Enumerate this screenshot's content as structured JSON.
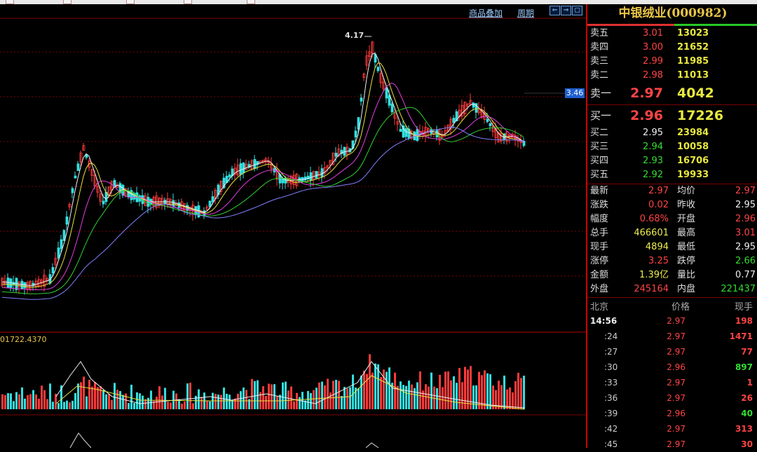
{
  "toolbar": {
    "overlay": "商品叠加",
    "period": "周期",
    "btn1": "⇐",
    "btn2": "⇒",
    "btn3": "▢"
  },
  "chart": {
    "high_label": "4.17",
    "price_tag": "3.46",
    "volume_label": "01722.4370"
  },
  "stock": {
    "name": "中银绒业(000982)"
  },
  "order_book": {
    "asks": [
      {
        "label": "卖五",
        "price": "3.01",
        "vol": "13023"
      },
      {
        "label": "卖四",
        "price": "3.00",
        "vol": "21652"
      },
      {
        "label": "卖三",
        "price": "2.99",
        "vol": "11985"
      },
      {
        "label": "卖二",
        "price": "2.98",
        "vol": "11013"
      },
      {
        "label": "卖一",
        "price": "2.97",
        "vol": "4042"
      }
    ],
    "bids": [
      {
        "label": "买一",
        "price": "2.96",
        "vol": "17226"
      },
      {
        "label": "买二",
        "price": "2.95",
        "vol": "23984"
      },
      {
        "label": "买三",
        "price": "2.94",
        "vol": "10058"
      },
      {
        "label": "买四",
        "price": "2.93",
        "vol": "16706"
      },
      {
        "label": "买五",
        "price": "2.92",
        "vol": "19933"
      }
    ]
  },
  "stats": [
    {
      "l1": "最新",
      "v1": "2.97",
      "l2": "均价",
      "v2": "2.97"
    },
    {
      "l1": "涨跌",
      "v1": "0.02",
      "l2": "昨收",
      "v2": "2.95"
    },
    {
      "l1": "幅度",
      "v1": "0.68%",
      "l2": "开盘",
      "v2": "2.96"
    },
    {
      "l1": "总手",
      "v1": "466601",
      "l2": "最高",
      "v2": "3.01"
    },
    {
      "l1": "现手",
      "v1": "4894",
      "l2": "最低",
      "v2": "2.95"
    },
    {
      "l1": "涨停",
      "v1": "3.25",
      "l2": "跌停",
      "v2": "2.66"
    },
    {
      "l1": "金额",
      "v1": "1.39亿",
      "l2": "量比",
      "v2": "0.77"
    },
    {
      "l1": "外盘",
      "v1": "245164",
      "l2": "内盘",
      "v2": "221437"
    }
  ],
  "ticks_header": {
    "place": "北京",
    "price": "价格",
    "vol": "现手"
  },
  "ticks": [
    {
      "time": "14:56",
      "price": "2.97",
      "vol": "198"
    },
    {
      "time": ":24",
      "price": "2.97",
      "vol": "1471"
    },
    {
      "time": ":27",
      "price": "2.97",
      "vol": "77"
    },
    {
      "time": ":30",
      "price": "2.96",
      "vol": "897"
    },
    {
      "time": ":33",
      "price": "2.97",
      "vol": "1"
    },
    {
      "time": ":36",
      "price": "2.97",
      "vol": "26"
    },
    {
      "time": ":39",
      "price": "2.96",
      "vol": "40"
    },
    {
      "time": ":42",
      "price": "2.97",
      "vol": "313"
    },
    {
      "time": ":45",
      "price": "2.97",
      "vol": "30"
    }
  ],
  "colors": {
    "up": "#ff3b3b",
    "down": "#33e0e0",
    "ma5": "#eeeeee",
    "ma10": "#e8e040",
    "ma20": "#e040e0",
    "ma30": "#30d030",
    "ma60": "#8080ff"
  }
}
